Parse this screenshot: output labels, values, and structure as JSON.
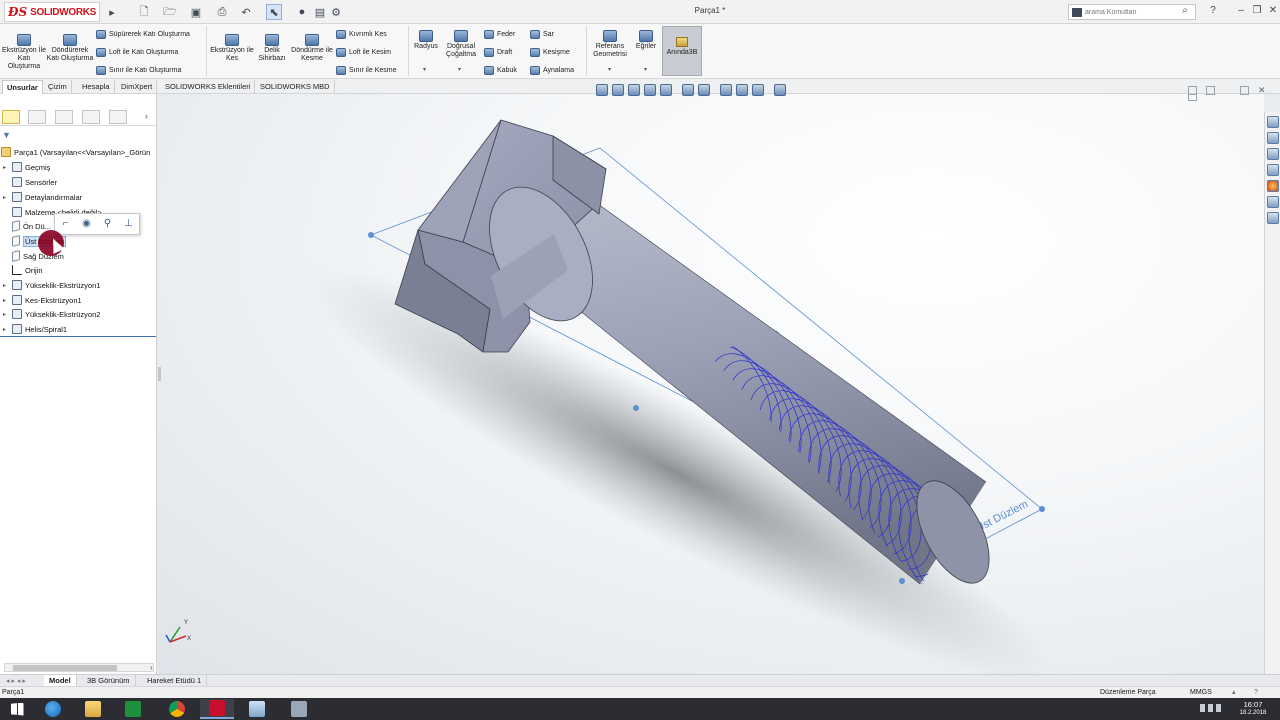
{
  "app": {
    "brand": "SOLIDWORKS",
    "document_title": "Parça1 *",
    "search_placeholder": "arama Komutları",
    "help_label": "?"
  },
  "ribbon": {
    "extrude_boss": "Ekstrüzyon İle Katı Oluşturma",
    "revolve_boss": "Döndürerek Katı Oluşturma",
    "swept_boss": "Süpürerek Katı Oluşturma",
    "loft_boss": "Loft ile Katı Oluşturma",
    "boundary_boss": "Sınır ile Katı Oluşturma",
    "extrude_cut": "Ekstrüzyon ile Kes",
    "hole_wizard": "Delik Sihirbazı",
    "revolve_cut": "Döndürme ile Kesme",
    "swept_cut": "Kıvrımlı Kes",
    "loft_cut": "Loft ile Kesim",
    "boundary_cut": "Sınır ile Kesme",
    "fillet": "Radyus",
    "linear_pattern": "Doğrusal Çoğaltma",
    "rib": "Feder",
    "draft": "Draft",
    "shell": "Kabuk",
    "wrap": "Sar",
    "intersect": "Kesişme",
    "mirror": "Aynalama",
    "reference_geometry": "Referans Geometrisi",
    "curves": "Eğriler",
    "instant3d": "Anında3B"
  },
  "tabs": [
    "Unsurlar",
    "Çizim",
    "Hesapla",
    "DimXpert",
    "SOLIDWORKS Eklentileri",
    "SOLIDWORKS MBD"
  ],
  "feature_tree": {
    "root": "Parça1  (Varsayılan<<Varsayılan>_Görün",
    "items": {
      "history": "Geçmiş",
      "sensors": "Sensörler",
      "annotations": "Detaylandırmalar",
      "material": "Malzeme <belirli değil>",
      "front_plane": "Ön Dü...",
      "top_plane": "Üst Düzlem",
      "right_plane": "Sağ Düzlem",
      "origin": "Orijin",
      "boss_extrude1": "Yükseklik-Ekstrüzyon1",
      "cut_extrude1": "Kes-Ekstrüzyon1",
      "boss_extrude2": "Yükseklik-Ekstrüzyon2",
      "helix1": "Helis/Spiral1"
    }
  },
  "viewport": {
    "plane_label": "Üst Düzlem",
    "triad_x": "X",
    "triad_y": "Y"
  },
  "bottom_tabs": [
    "Model",
    "3B Görünüm",
    "Hareket Etüdü 1"
  ],
  "status": {
    "left": "Parça1",
    "mode": "Düzenleme Parça",
    "units": "MMGS"
  },
  "clock": {
    "time": "16:07",
    "date": "18.2.2018"
  },
  "colors": {
    "brand_red": "#d1111b",
    "selection_blue": "#cce0f7",
    "helix_blue": "#2a2fd0",
    "part_gray": "#9a9fb3"
  }
}
